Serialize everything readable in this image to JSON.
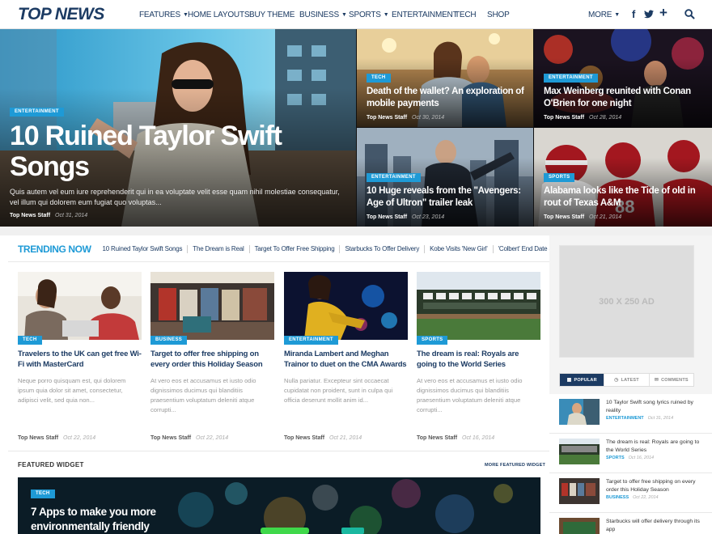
{
  "header": {
    "logo": "TOP NEWS",
    "nav": [
      {
        "label": "FEATURES",
        "dropdown": true
      },
      {
        "label": "HOME LAYOUTS",
        "dropdown": false
      },
      {
        "label": "BUY THEME",
        "dropdown": false
      },
      {
        "label": "BUSINESS",
        "dropdown": true
      },
      {
        "label": "SPORTS",
        "dropdown": true
      },
      {
        "label": "ENTERTAINMENT",
        "dropdown": false
      },
      {
        "label": "TECH",
        "dropdown": false
      },
      {
        "label": "SHOP",
        "dropdown": false
      }
    ],
    "more_label": "MORE",
    "social_icons": [
      "facebook-icon",
      "twitter-icon",
      "plus-icon",
      "search-icon"
    ]
  },
  "featured": {
    "main": {
      "category": "ENTERTAINMENT",
      "title": "10 Ruined Taylor Swift Songs",
      "excerpt": "Quis autem vel eum iure reprehenderit qui in ea voluptate velit esse quam nihil molestiae consequatur, vel illum qui dolorem eum fugiat quo voluptas...",
      "author": "Top News Staff",
      "date": "Oct 31, 2014"
    },
    "tiles": [
      {
        "category": "TECH",
        "title": "Death of the wallet? An exploration of mobile payments",
        "author": "Top News Staff",
        "date": "Oct 30, 2014"
      },
      {
        "category": "ENTERTAINMENT",
        "title": "Max Weinberg reunited with Conan O'Brien for one night",
        "author": "Top News Staff",
        "date": "Oct 28, 2014"
      },
      {
        "category": "ENTERTAINMENT",
        "title": "10 Huge reveals from the \"Avengers: Age of Ultron\" trailer leak",
        "author": "Top News Staff",
        "date": "Oct 23, 2014"
      },
      {
        "category": "SPORTS",
        "title": "Alabama looks like the Tide of old in rout of Texas A&M",
        "author": "Top News Staff",
        "date": "Oct 21, 2014"
      }
    ]
  },
  "trending": {
    "heading": "TRENDING NOW",
    "items": [
      "10 Ruined Taylor Swift Songs",
      "The Dream is Real",
      "Target To Offer Free Shipping",
      "Starbucks To Offer Delivery",
      "Kobe Visits 'New Girl'",
      "'Colbert' End Date Set"
    ]
  },
  "cards": [
    {
      "category": "TECH",
      "title": "Travelers to the UK can get free Wi-Fi with MasterCard",
      "excerpt": "Neque porro quisquam est, qui dolorem ipsum quia dolor sit amet, consectetur, adipisci velit, sed quia non...",
      "author": "Top News Staff",
      "date": "Oct 22, 2014"
    },
    {
      "category": "BUSINESS",
      "title": "Target to offer free shipping on every order this Holiday Season",
      "excerpt": "At vero eos et accusamus et iusto odio dignissimos ducimus qui blanditiis praesentium voluptatum deleniti atque corrupti...",
      "author": "Top News Staff",
      "date": "Oct 22, 2014"
    },
    {
      "category": "ENTERTAINMENT",
      "title": "Miranda Lambert and Meghan Trainor to duet on the CMA Awards",
      "excerpt": "Nulla pariatur. Excepteur sint occaecat cupidatat non proident, sunt in culpa qui officia deserunt mollit anim id...",
      "author": "Top News Staff",
      "date": "Oct 21, 2014"
    },
    {
      "category": "SPORTS",
      "title": "The dream is real: Royals are going to the World Series",
      "excerpt": "At vero eos et accusamus et iusto odio dignissimos ducimus qui blanditiis praesentium voluptatum deleniti atque corrupti...",
      "author": "Top News Staff",
      "date": "Oct 16, 2014"
    }
  ],
  "featured_widget": {
    "heading": "FEATURED WIDGET",
    "more_label": "MORE FEATURED WIDGET",
    "category": "TECH",
    "title": "7 Apps to make you more environmentally friendly"
  },
  "sidebar": {
    "ad_label": "300 X 250 AD",
    "tabs": [
      {
        "label": "POPULAR",
        "icon": "chart-icon",
        "active": true
      },
      {
        "label": "LATEST",
        "icon": "clock-icon",
        "active": false
      },
      {
        "label": "COMMENTS",
        "icon": "comments-icon",
        "active": false
      }
    ],
    "posts": [
      {
        "title": "10 Taylor Swift song lyrics ruined by reality",
        "category": "ENTERTAINMENT",
        "date": "Oct 31, 2014"
      },
      {
        "title": "The dream is real: Royals are going to the World Series",
        "category": "SPORTS",
        "date": "Oct 16, 2014"
      },
      {
        "title": "Target to offer free shipping on every order this Holiday Season",
        "category": "BUSINESS",
        "date": "Oct 22, 2014"
      },
      {
        "title": "Starbucks will offer delivery through its app",
        "category": "",
        "date": ""
      }
    ]
  },
  "colors": {
    "brand_navy": "#1c3b63",
    "accent_blue": "#1e9ad6"
  }
}
